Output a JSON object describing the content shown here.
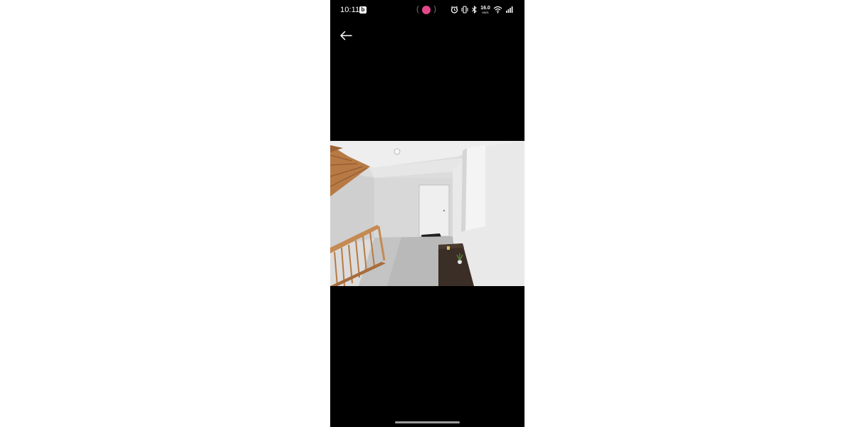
{
  "status_bar": {
    "time": "10:11",
    "app_badge": "b",
    "net_speed_value": "16.0",
    "net_speed_unit": "KB/S",
    "icons": [
      "alarm-icon",
      "vibrate-icon",
      "bluetooth-icon",
      "wifi-icon",
      "signal-icon"
    ],
    "center_indicator_color": "#e4488a"
  },
  "toolbar": {
    "back_icon": "arrow-left-icon"
  },
  "photo": {
    "subject": "interior-photo"
  },
  "colors": {
    "background": "#000000",
    "page": "#ffffff",
    "accent": "#e4488a"
  }
}
